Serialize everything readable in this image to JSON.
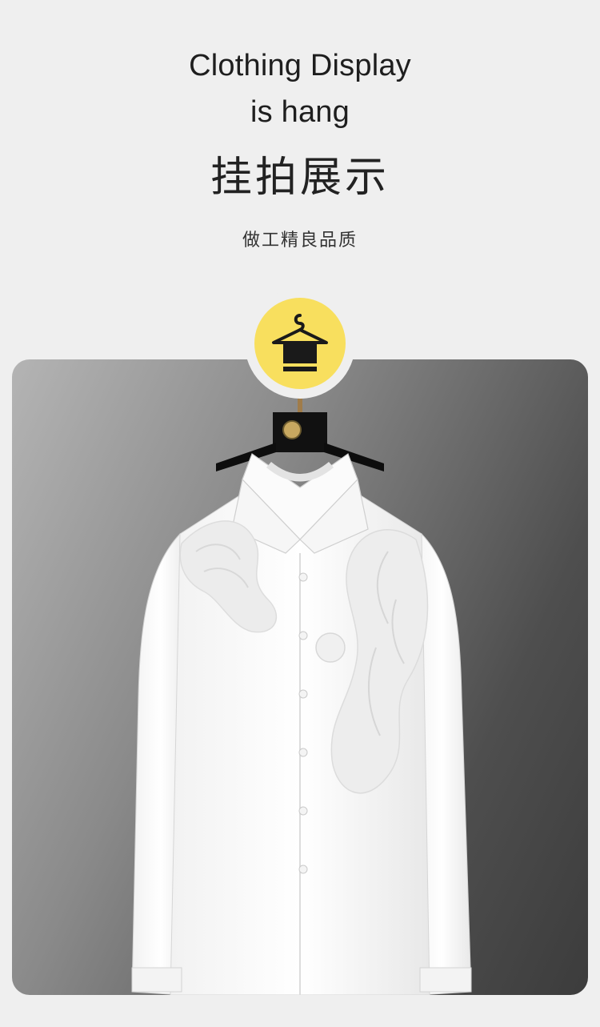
{
  "header": {
    "title_en_line1": "Clothing Display",
    "title_en_line2": "is hang",
    "title_cn": "挂拍展示",
    "subtitle_cn": "做工精良品质"
  },
  "badge": {
    "icon": "hanger-icon",
    "color": "#f8df5e"
  },
  "photo": {
    "subject": "white-shirt-on-hanger",
    "icon": "shirt-photo"
  }
}
